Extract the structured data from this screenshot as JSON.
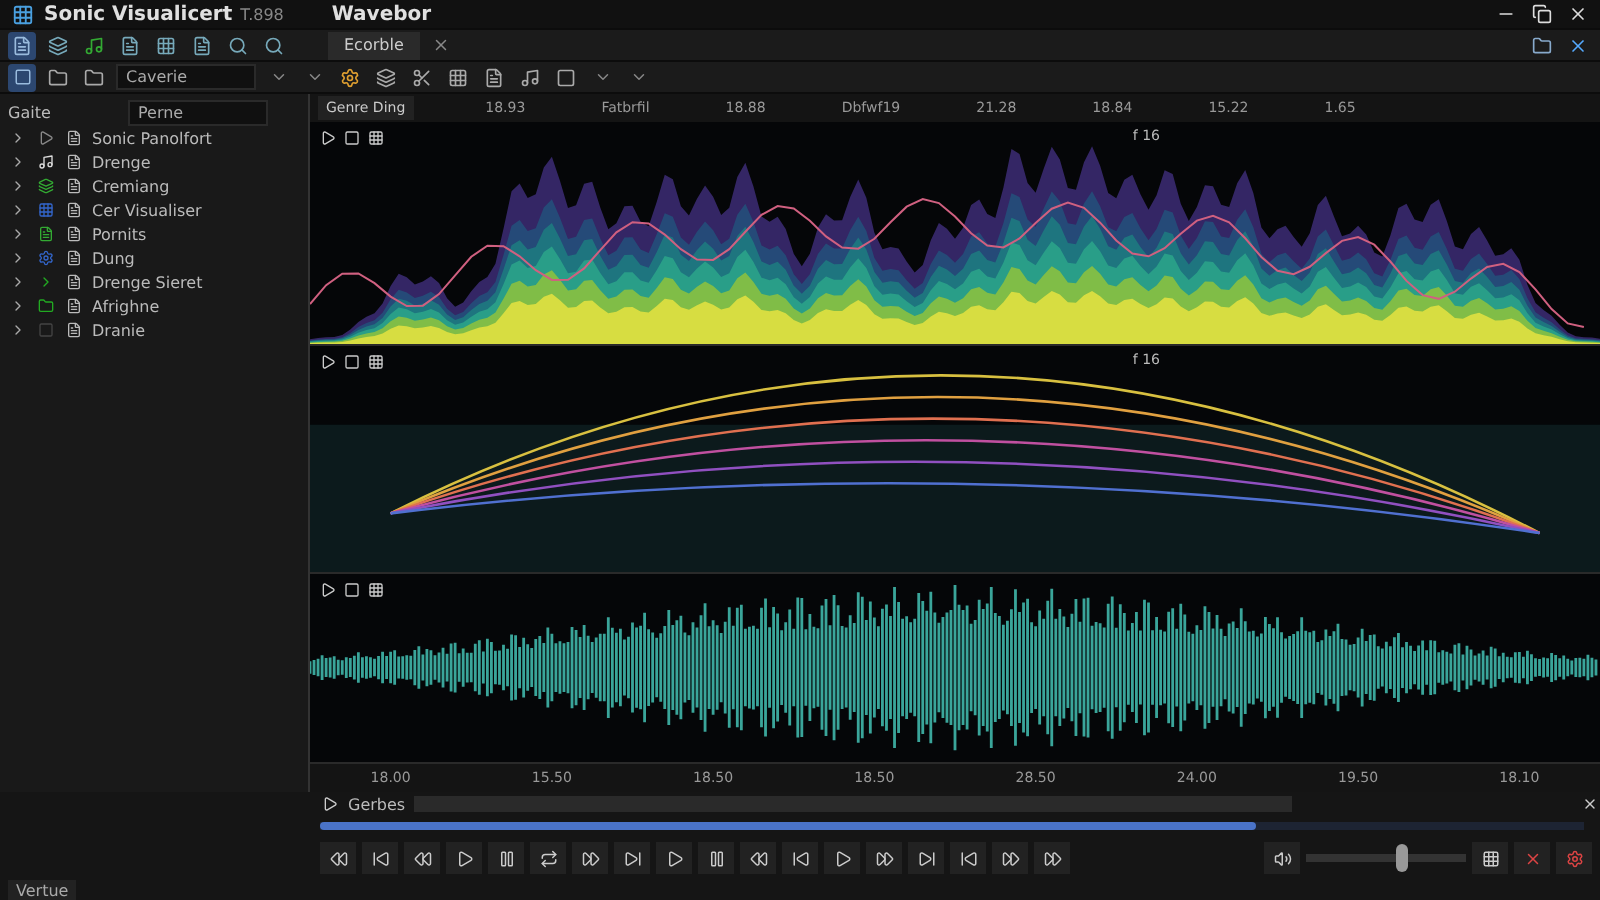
{
  "window": {
    "title": "Sonic Visualicert",
    "subtitle": "T.898",
    "document": "Wavebor"
  },
  "tabs": [
    {
      "label": "Ecorble",
      "selected": true
    }
  ],
  "left_toolbar": {
    "field": "Caverie"
  },
  "sidebar": {
    "columns": [
      "Gaite",
      "Perne"
    ],
    "items": [
      {
        "label": "Sonic Panolfort"
      },
      {
        "label": "Drenge"
      },
      {
        "label": "Cremiang"
      },
      {
        "label": "Cer Visualiser"
      },
      {
        "label": "Pornits"
      },
      {
        "label": "Dung"
      },
      {
        "label": "Drenge Sieret"
      },
      {
        "label": "Afrighne"
      },
      {
        "label": "Dranie"
      }
    ]
  },
  "layer_button": "Genre Ding",
  "top_ruler": [
    "18.93",
    "Fatbrfil",
    "18.88",
    "Dbfwf19",
    "21.28",
    "18.84",
    "15.22",
    "1.65"
  ],
  "panes": [
    {
      "kind": "spectrogram",
      "readout": "f 16"
    },
    {
      "kind": "curves",
      "readout": "f 16"
    },
    {
      "kind": "waveform"
    }
  ],
  "bottom_ruler": [
    "18.00",
    "15.50",
    "18.50",
    "18.50",
    "28.50",
    "24.00",
    "19.50",
    "18.10"
  ],
  "playback": {
    "label": "Gerbes",
    "level": 0.74
  },
  "volume": {
    "level": 0.6
  },
  "status_bar": "Vertue"
}
